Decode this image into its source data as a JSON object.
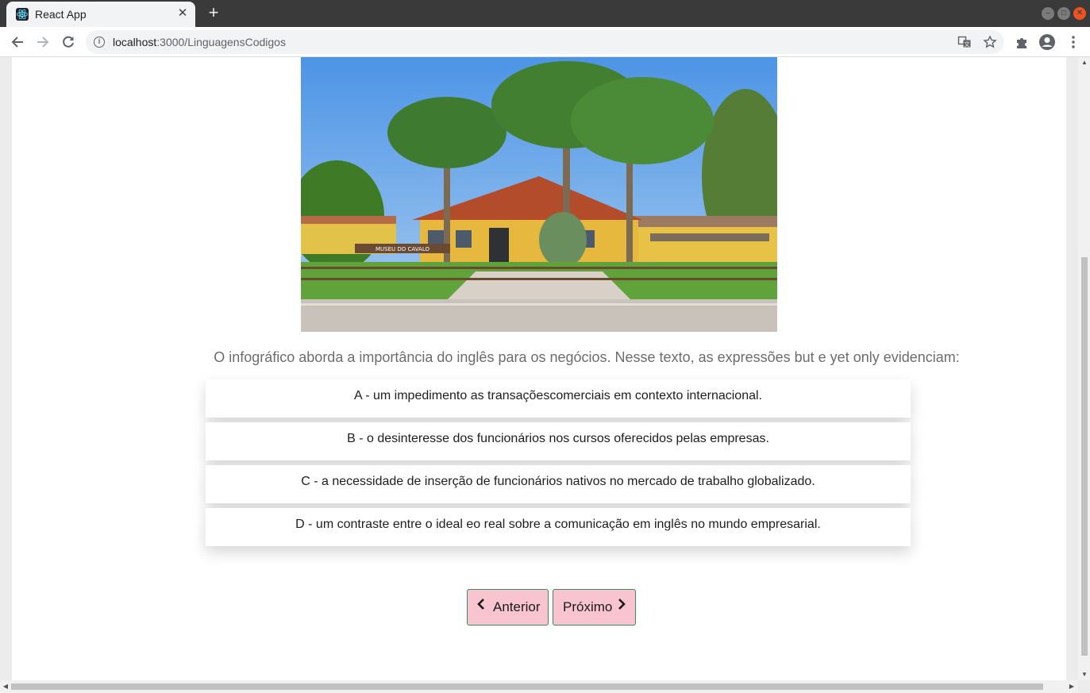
{
  "browser": {
    "tab_title": "React App",
    "url_host": "localhost",
    "url_path": ":3000/LinguagensCodigos"
  },
  "quiz": {
    "question": "O infográfico aborda a importância do inglês para os negócios. Nesse texto, as expressões but e yet only evidenciam:",
    "image_sign_text": "MUSEU DO CAVALO",
    "options": [
      "A - um impedimento as transaçõescomerciais em contexto internacional.",
      "B - o desinteresse dos funcionários nos cursos oferecidos pelas empresas.",
      "C - a necessidade de inserção de funcionários nativos no mercado de trabalho globalizado.",
      "D - um contraste entre o ideal eo real sobre a comunicação em inglês no mundo empresarial."
    ],
    "prev_label": "Anterior",
    "next_label": "Próximo"
  },
  "colors": {
    "button_bg": "#f7c4d0",
    "button_border": "#3c8a5a",
    "question_text": "#6c6c6c"
  }
}
